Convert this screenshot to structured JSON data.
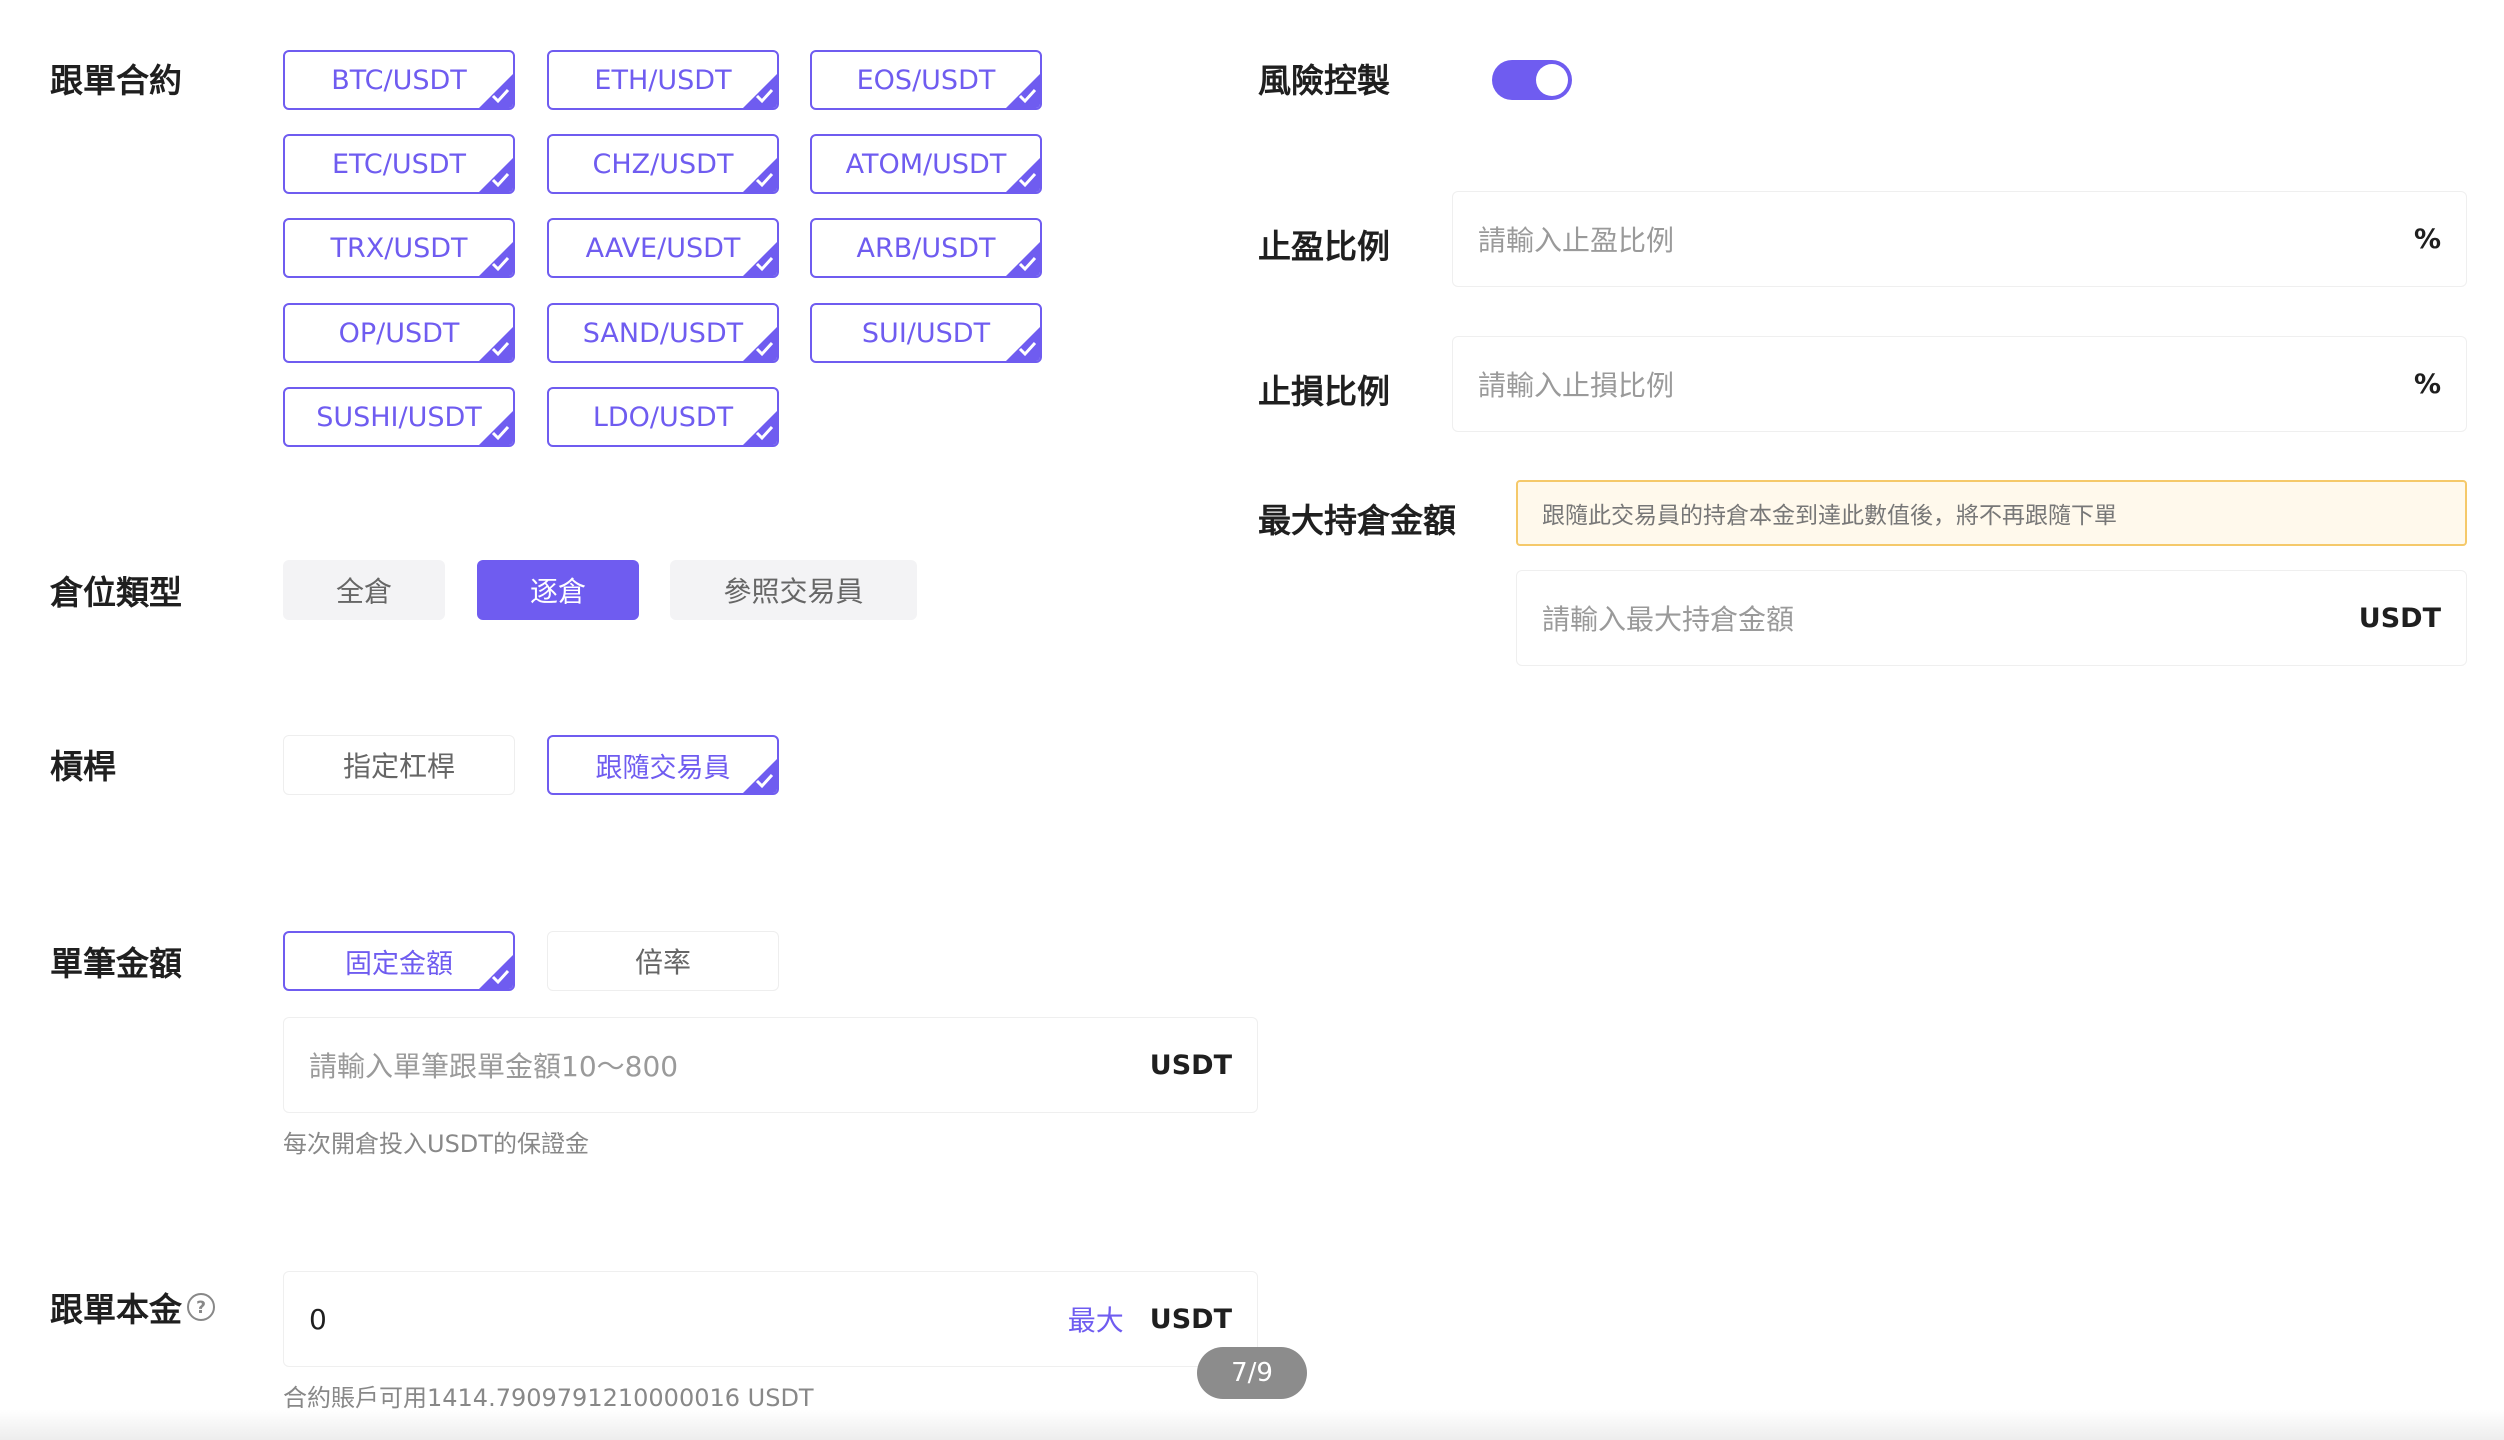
{
  "colors": {
    "accent": "#6f5cf0",
    "warning_bg": "#fff9ec",
    "warning_border": "#f5c96a"
  },
  "contracts": {
    "label": "跟單合約",
    "items": [
      "BTC/USDT",
      "ETH/USDT",
      "EOS/USDT",
      "ETC/USDT",
      "CHZ/USDT",
      "ATOM/USDT",
      "TRX/USDT",
      "AAVE/USDT",
      "ARB/USDT",
      "OP/USDT",
      "SAND/USDT",
      "SUI/USDT",
      "SUSHI/USDT",
      "LDO/USDT"
    ]
  },
  "position_type": {
    "label": "倉位類型",
    "options": [
      "全倉",
      "逐倉",
      "參照交易員"
    ],
    "selected": "逐倉"
  },
  "leverage": {
    "label": "槓桿",
    "options": [
      "指定杠桿",
      "跟隨交易員"
    ],
    "selected": "跟隨交易員"
  },
  "single_amount": {
    "label": "單筆金額",
    "options": [
      "固定金額",
      "倍率"
    ],
    "selected": "固定金額",
    "placeholder": "請輸入單筆跟單金額10～800",
    "unit": "USDT",
    "hint": "每次開倉投入USDT的保證金"
  },
  "principal": {
    "label": "跟單本金",
    "help_icon": "question-circle-icon",
    "value": "0",
    "max_label": "最大",
    "unit": "USDT",
    "available": "合約賬戶可用1414.7909791210000016 USDT"
  },
  "risk_control": {
    "label": "風險控製",
    "enabled": true
  },
  "take_profit": {
    "label": "止盈比例",
    "placeholder": "請輸入止盈比例",
    "unit": "%"
  },
  "stop_loss": {
    "label": "止損比例",
    "placeholder": "請輸入止損比例",
    "unit": "%"
  },
  "max_position": {
    "label": "最大持倉金額",
    "notice": "跟隨此交易員的持倉本金到達此數值後，將不再跟隨下單",
    "placeholder": "請輸入最大持倉金額",
    "unit": "USDT"
  },
  "pager": {
    "text": "7/9"
  }
}
